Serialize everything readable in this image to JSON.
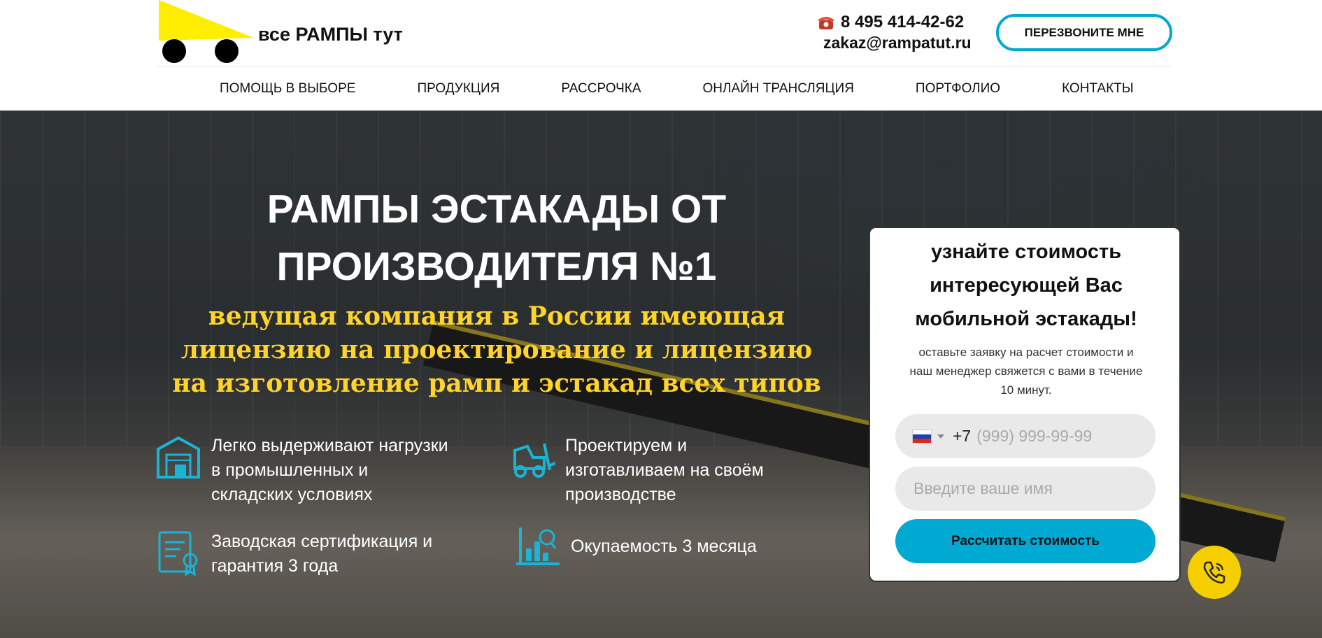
{
  "header": {
    "logo_text": "все РАМПЫ тут",
    "phone": "8 495 414-42-62",
    "email": "zakaz@rampatut.ru",
    "callback_label": "ПЕРЕЗВОНИТЕ МНЕ",
    "colors": {
      "accent": "#00a9d1",
      "logo_yellow": "#ffee00"
    }
  },
  "nav": {
    "items": [
      {
        "label": "ПОМОЩЬ В ВЫБОРЕ"
      },
      {
        "label": "ПРОДУКЦИЯ"
      },
      {
        "label": "РАССРОЧКА"
      },
      {
        "label": "ОНЛАЙН ТРАНСЛЯЦИЯ"
      },
      {
        "label": "ПОРТФОЛИО"
      },
      {
        "label": "КОНТАКТЫ"
      }
    ]
  },
  "hero": {
    "title_line1": "РАМПЫ ЭСТАКАДЫ ОТ",
    "title_line2": "ПРОИЗВОДИТЕЛЯ №1",
    "subtitle_line1": "ведущая компания в России имеющая",
    "subtitle_line2": "лицензию на проектирование и лицензию",
    "subtitle_line3": "на изготовление рамп и эстакад всех типов",
    "subtitle_color": "#ffd42a",
    "features": [
      {
        "icon": "warehouse-icon",
        "line1": "Легко выдерживают нагрузки",
        "line2": "в промышленных и",
        "line3": "складских условиях"
      },
      {
        "icon": "forklift-icon",
        "line1": "Проектируем и",
        "line2": "изготавливаем на своём",
        "line3": "производстве"
      },
      {
        "icon": "certificate-icon",
        "line1": "Заводская сертификация и",
        "line2": "гарантия 3 года"
      },
      {
        "icon": "payback-chart-icon",
        "line1": "Окупаемость 3 месяца"
      }
    ]
  },
  "form": {
    "title_line1": "узнайте стоимость",
    "title_line2": "интересующей Вас",
    "title_line3": "мобильной эстакады!",
    "text_line1": "оставьте заявку на расчет стоимости и",
    "text_line2": "наш менеджер свяжется с вами в течение",
    "text_line3": "10 минут.",
    "phone_prefix": "+7",
    "phone_placeholder": "(999) 999-99-99",
    "name_placeholder": "Введите ваше имя",
    "submit_label": "Рассчитать стоимость"
  },
  "floating": {
    "icon": "phone-call-icon"
  }
}
